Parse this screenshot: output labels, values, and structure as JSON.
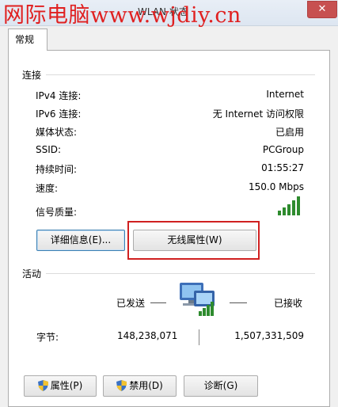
{
  "window": {
    "title": "WLAN 状态",
    "watermark": "网际电脑www.wjdiy.cn",
    "close_glyph": "✕"
  },
  "tabs": [
    {
      "label": "常规"
    }
  ],
  "connection": {
    "section_title": "连接",
    "rows": [
      {
        "label": "IPv4 连接:",
        "value": "Internet"
      },
      {
        "label": "IPv6 连接:",
        "value": "无 Internet 访问权限"
      },
      {
        "label": "媒体状态:",
        "value": "已启用"
      },
      {
        "label": "SSID:",
        "value": "PCGroup"
      },
      {
        "label": "持续时间:",
        "value": "01:55:27"
      },
      {
        "label": "速度:",
        "value": "150.0 Mbps"
      }
    ],
    "signal_label": "信号质量:",
    "signal_bars": 5,
    "signal_bars_total": 5,
    "details_button": "详细信息(E)...",
    "wireless_props_button": "无线属性(W)"
  },
  "activity": {
    "section_title": "活动",
    "sent_label": "已发送",
    "received_label": "已接收",
    "bytes_label": "字节:",
    "bytes_sent": "148,238,071",
    "bytes_received": "1,507,331,509"
  },
  "footer": {
    "properties_button": "属性(P)",
    "disable_button": "禁用(D)",
    "diagnose_button": "诊断(G)"
  },
  "colors": {
    "highlight": "#d02020",
    "signal": "#2e8b2e",
    "watermark": "#e02020"
  },
  "icons": {
    "signal": "signal-strength-icon",
    "network": "network-computers-icon",
    "shield": "uac-shield-icon"
  }
}
